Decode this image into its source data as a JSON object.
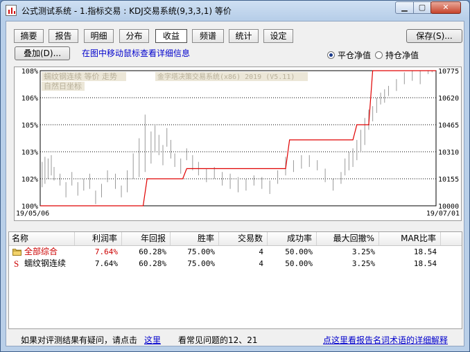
{
  "window": {
    "title": "公式测试系统 - 1.指标交易 : KDJ交易系统(9,3,3,1) 等价",
    "min_glyph": "▁",
    "max_glyph": "▢",
    "close_glyph": "✕"
  },
  "tabs": [
    {
      "label": "摘要",
      "active": false
    },
    {
      "label": "报告",
      "active": false
    },
    {
      "label": "明细",
      "active": false
    },
    {
      "label": "分布",
      "active": false
    },
    {
      "label": "收益",
      "active": true
    },
    {
      "label": "频谱",
      "active": false
    },
    {
      "label": "统计",
      "active": false
    },
    {
      "label": "设定",
      "active": false
    }
  ],
  "toolbar": {
    "save_label": "保存(S)...",
    "overlay_label": "叠加(D)...",
    "hint": "在图中移动鼠标查看详细信息",
    "radio_flat_label": "平仓净值",
    "radio_hold_label": "持仓净值",
    "selected_radio": "平仓净值"
  },
  "chart_data": {
    "type": "line",
    "overlay_series": "蠕纹钢连续 等价 走势",
    "overlay_scale": "自然日坐标",
    "system_caption": "金字塔决策交易系统(x86) 2019 (V5.11)",
    "left_axis": {
      "labels": [
        "108%",
        "106%",
        "105%",
        "103%",
        "102%",
        "100%"
      ],
      "ylim": [
        100,
        108
      ]
    },
    "right_axis": {
      "labels": [
        "10775",
        "10620",
        "10465",
        "10310",
        "10155",
        "10000"
      ],
      "ylim": [
        10000,
        10775
      ]
    },
    "x_start": "19/05/06",
    "x_end": "19/07/01",
    "series": [
      {
        "name": "平仓净值",
        "color": "#e00000",
        "x": [
          0,
          0.26,
          0.27,
          0.36,
          0.37,
          0.62,
          0.63,
          0.79,
          0.8,
          0.83,
          0.84,
          0.91,
          0.92,
          1.0
        ],
        "values": [
          100,
          100,
          101.6,
          101.6,
          102.2,
          102.2,
          103.9,
          103.9,
          104.8,
          104.8,
          108.4,
          108.4,
          110,
          110
        ]
      }
    ],
    "price_bars": {
      "color": "#999999",
      "x": [
        0.005,
        0.012,
        0.02,
        0.028,
        0.035,
        0.05,
        0.065,
        0.08,
        0.095,
        0.11,
        0.125,
        0.14,
        0.155,
        0.17,
        0.19,
        0.205,
        0.22,
        0.235,
        0.25,
        0.265,
        0.28,
        0.29,
        0.3,
        0.31,
        0.32,
        0.33,
        0.34,
        0.355,
        0.37,
        0.385,
        0.4,
        0.42,
        0.44,
        0.46,
        0.48,
        0.5,
        0.52,
        0.54,
        0.56,
        0.58,
        0.6,
        0.62,
        0.64,
        0.66,
        0.68,
        0.7,
        0.72,
        0.74,
        0.76,
        0.77,
        0.78,
        0.79,
        0.8,
        0.81,
        0.82,
        0.83,
        0.84,
        0.85,
        0.86,
        0.87,
        0.88,
        0.9,
        0.92,
        0.94,
        0.96,
        0.98,
        0.99
      ],
      "low": [
        101.1,
        101.3,
        101.6,
        101.8,
        101.5,
        101.2,
        100.5,
        101.2,
        100.6,
        100.9,
        101.0,
        100.1,
        100.5,
        101.4,
        101.0,
        100.5,
        100.8,
        101.6,
        101.7,
        102.0,
        102.5,
        103.2,
        103.0,
        102.4,
        103.5,
        102.8,
        102.3,
        101.9,
        102.7,
        102.1,
        101.8,
        101.4,
        101.6,
        101.2,
        101.0,
        100.8,
        100.9,
        101.2,
        101.0,
        100.7,
        101.3,
        101.8,
        102.0,
        102.2,
        102.3,
        102.1,
        101.4,
        100.9,
        101.3,
        101.8,
        102.1,
        102.3,
        102.7,
        103.2,
        103.6,
        104.5,
        105.0,
        105.5,
        106.0,
        106.1,
        106.5,
        106.8,
        107.2,
        107.4,
        107.2,
        107.8,
        107.9
      ],
      "high": [
        102.6,
        102.9,
        102.8,
        103.0,
        102.3,
        101.9,
        101.4,
        102.0,
        101.4,
        101.6,
        101.9,
        100.9,
        101.3,
        102.1,
        101.9,
        101.2,
        102.1,
        103.1,
        104.0,
        105.4,
        104.4,
        104.8,
        104.2,
        103.6,
        104.6,
        103.9,
        103.1,
        102.8,
        103.4,
        103.0,
        102.6,
        102.2,
        102.3,
        102.0,
        101.9,
        101.7,
        101.6,
        101.8,
        101.7,
        101.5,
        102.1,
        102.9,
        102.7,
        103.0,
        103.0,
        102.7,
        102.2,
        101.6,
        102.0,
        102.8,
        103.2,
        103.4,
        103.9,
        104.5,
        105.2,
        105.7,
        105.9,
        106.4,
        106.7,
        106.9,
        107.1,
        107.5,
        107.9,
        108.2,
        108.3,
        108.6,
        108.7
      ]
    }
  },
  "table": {
    "columns": [
      "名称",
      "利润率",
      "年回报",
      "胜率",
      "交易数",
      "成功率",
      "最大回撤%",
      "MAR比率"
    ],
    "rows": [
      {
        "icon": "folder-icon",
        "name": "全部综合",
        "name_color": "#cc0000",
        "value_color": "#cc0000",
        "cells": [
          "7.64%",
          "60.28%",
          "75.00%",
          "4",
          "50.00%",
          "3.25%",
          "18.54"
        ]
      },
      {
        "icon": "s-icon",
        "name": "蠕纹钢连续",
        "name_color": "#000000",
        "value_color": "#000000",
        "cells": [
          "7.64%",
          "60.28%",
          "75.00%",
          "4",
          "50.00%",
          "3.25%",
          "18.54"
        ]
      }
    ]
  },
  "footer": {
    "prefix": "如果对评测结果有疑问，请点击",
    "link": "这里",
    "suffix": "看常见问题的12、21",
    "right_link": "点这里看报告名词术语的详细解释"
  }
}
